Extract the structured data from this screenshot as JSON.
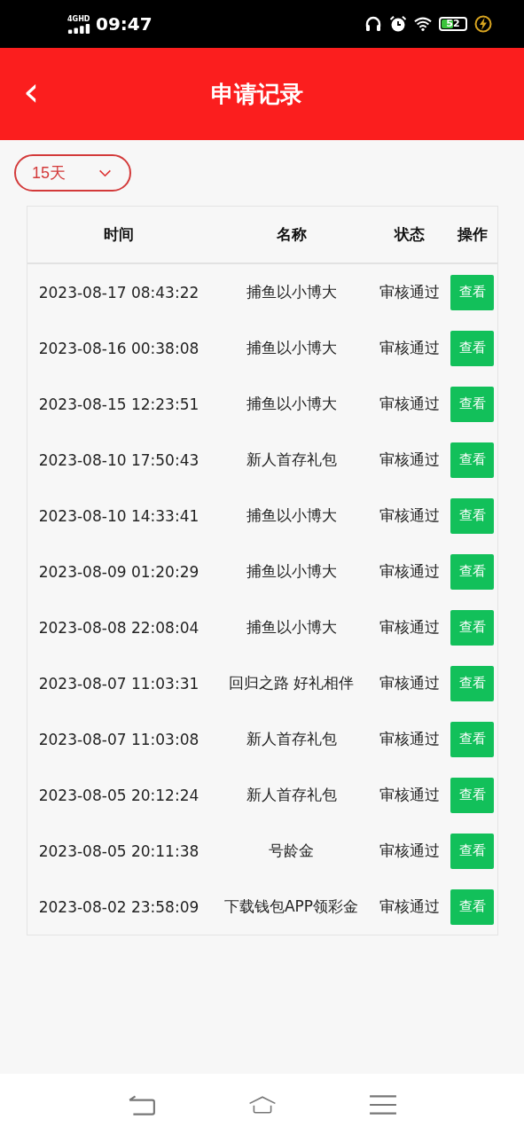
{
  "status_bar": {
    "network": "4GHD",
    "time": "09:47",
    "battery": "52"
  },
  "header": {
    "back": "‹",
    "title": "申请记录"
  },
  "filter": {
    "value": "15天"
  },
  "table": {
    "columns": [
      "时间",
      "名称",
      "状态",
      "操作"
    ],
    "rows": [
      {
        "time": "2023-08-17 08:43:22",
        "name": "捕鱼以小博大",
        "status": "审核通过",
        "action": "查看"
      },
      {
        "time": "2023-08-16 00:38:08",
        "name": "捕鱼以小博大",
        "status": "审核通过",
        "action": "查看"
      },
      {
        "time": "2023-08-15 12:23:51",
        "name": "捕鱼以小博大",
        "status": "审核通过",
        "action": "查看"
      },
      {
        "time": "2023-08-10 17:50:43",
        "name": "新人首存礼包",
        "status": "审核通过",
        "action": "查看"
      },
      {
        "time": "2023-08-10 14:33:41",
        "name": "捕鱼以小博大",
        "status": "审核通过",
        "action": "查看"
      },
      {
        "time": "2023-08-09 01:20:29",
        "name": "捕鱼以小博大",
        "status": "审核通过",
        "action": "查看"
      },
      {
        "time": "2023-08-08 22:08:04",
        "name": "捕鱼以小博大",
        "status": "审核通过",
        "action": "查看"
      },
      {
        "time": "2023-08-07 11:03:31",
        "name": "回归之路 好礼相伴",
        "status": "审核通过",
        "action": "查看"
      },
      {
        "time": "2023-08-07 11:03:08",
        "name": "新人首存礼包",
        "status": "审核通过",
        "action": "查看"
      },
      {
        "time": "2023-08-05 20:12:24",
        "name": "新人首存礼包",
        "status": "审核通过",
        "action": "查看"
      },
      {
        "time": "2023-08-05 20:11:38",
        "name": "号龄金",
        "status": "审核通过",
        "action": "查看"
      },
      {
        "time": "2023-08-02 23:58:09",
        "name": "下载钱包APP领彩金",
        "status": "审核通过",
        "action": "查看"
      }
    ]
  }
}
